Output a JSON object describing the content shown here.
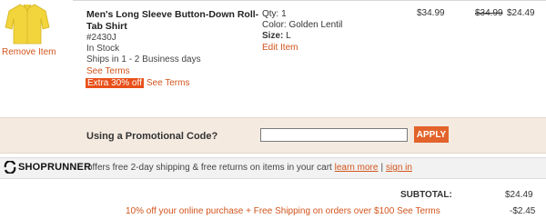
{
  "item": {
    "name": "Men's Long Sleeve Button-Down Roll-Tab Shirt",
    "sku": "#2430J",
    "stock": "In Stock",
    "ship": "Ships in 1 - 2 Business days",
    "see_terms": "See Terms",
    "promo_badge": "Extra 30% off",
    "promo_terms": "See Terms",
    "remove": "Remove Item",
    "qty": "Qty: 1",
    "color": "Color: Golden Lentil",
    "size_label": "Size:",
    "size_value": "L",
    "edit": "Edit Item",
    "price": "$34.99",
    "was_price": "$34.99",
    "now_price": "$24.49",
    "thumb_color": "#f2d43c"
  },
  "promo": {
    "label": "Using a Promotional Code?",
    "input_value": "",
    "apply": "APPLY"
  },
  "shoprunner": {
    "logo": "SHOPRUNNER",
    "text": "offers free 2-day shipping & free returns on items in your cart",
    "learn_more": "learn more",
    "sep": "|",
    "sign_in": "sign in"
  },
  "totals": {
    "subtotal_label": "SUBTOTAL:",
    "subtotal_value": "$24.49",
    "offer_text": "10% off your online purchase + Free Shipping on orders over $100",
    "offer_terms": "See Terms",
    "discount_value": "-$2.45"
  },
  "colors": {
    "accent": "#d2541c",
    "promo_badge_bg": "#e8501a",
    "apply_bg": "#e2632b",
    "promo_band_bg": "#f4eae0",
    "shoprunner_band_bg": "#f2f2f2"
  }
}
